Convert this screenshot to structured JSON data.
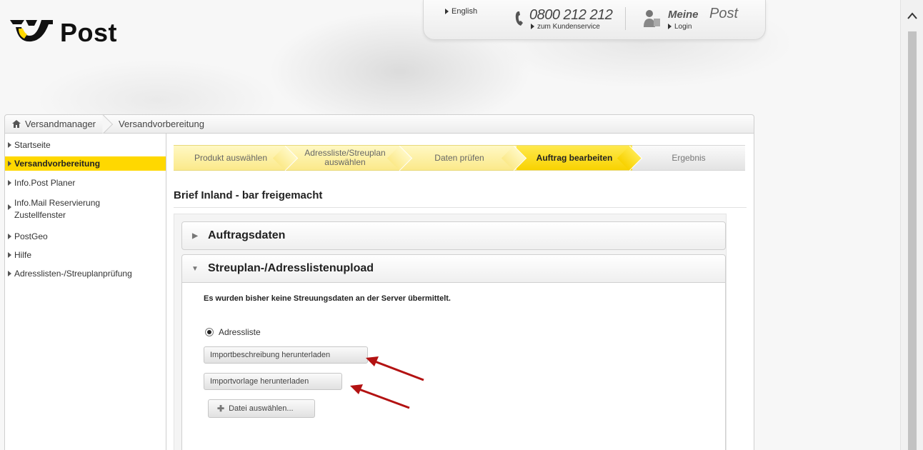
{
  "header": {
    "logo_text": "Post",
    "english_link": "English",
    "phone_number": "0800 212 212",
    "phone_sub": "zum Kundenservice",
    "meine": "Meine",
    "post": "Post",
    "login": "Login"
  },
  "breadcrumb": {
    "home": "Versandmanager",
    "current": "Versandvorbereitung"
  },
  "sidebar": {
    "items": [
      {
        "label": "Startseite",
        "active": false
      },
      {
        "label": "Versandvorbereitung",
        "active": true
      },
      {
        "label": "Info.Post Planer",
        "active": false
      },
      {
        "label": "Info.Mail Reservierung",
        "label2": "Zustellfenster",
        "active": false
      },
      {
        "label": "PostGeo",
        "active": false
      },
      {
        "label": "Hilfe",
        "active": false
      },
      {
        "label": "Adresslisten-/Streuplanprüfung",
        "active": false
      }
    ]
  },
  "steps": [
    {
      "label": "Produkt auswählen",
      "state": "done"
    },
    {
      "label": "Adressliste/Streuplan",
      "label2": "auswählen",
      "state": "done"
    },
    {
      "label": "Daten prüfen",
      "state": "done"
    },
    {
      "label": "Auftrag bearbeiten",
      "state": "active"
    },
    {
      "label": "Ergebnis",
      "state": "pending"
    }
  ],
  "main": {
    "heading": "Brief Inland - bar freigemacht",
    "panel1_title": "Auftragsdaten",
    "panel2_title": "Streuplan-/Adresslistenupload",
    "info_text": "Es wurden bisher keine Streuungsdaten an der Server übermittelt.",
    "radio_label": "Adressliste",
    "btn_description": "Importbeschreibung herunterladen",
    "btn_template": "Importvorlage herunterladen",
    "btn_file": "Datei auswählen..."
  },
  "colors": {
    "brand_yellow": "#ffd800",
    "arrow_red": "#b31212"
  }
}
